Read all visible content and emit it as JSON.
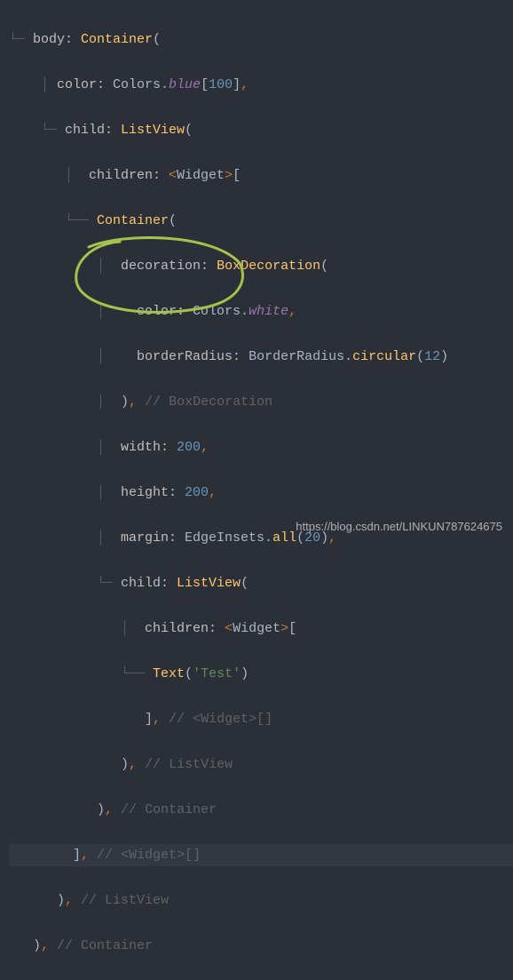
{
  "code": {
    "l1": {
      "tree": "└─ ",
      "p": "body: ",
      "cls": "Container",
      "open": "("
    },
    "l2": {
      "tree": "    │ ",
      "p": "color: ",
      "id": "Colors.",
      "ital": "blue",
      "br": "[",
      "n": "100",
      "cl": "]",
      "comma": ","
    },
    "l3": {
      "tree": "    └─ ",
      "p": "child: ",
      "cls": "ListView",
      "open": "("
    },
    "l4": {
      "tree": "       │  ",
      "p": "children: ",
      "ang1": "<",
      "w": "Widget",
      "ang2": ">",
      "open": "["
    },
    "l5": {
      "tree": "       └── ",
      "cls": "Container",
      "open": "("
    },
    "l6": {
      "tree": "           │  ",
      "p": "decoration: ",
      "cls": "BoxDecoration",
      "open": "("
    },
    "l7": {
      "tree": "           │    ",
      "p": "color: ",
      "id": "Colors.",
      "ital": "white",
      "comma": ","
    },
    "l8": {
      "tree": "           │    ",
      "p": "borderRadius: ",
      "id": "BorderRadius.",
      "m": "circular",
      "open": "(",
      "n": "12",
      "close": ")"
    },
    "l9": {
      "tree": "           │  ",
      "close": ")",
      "comma": ",",
      "cmt": " // BoxDecoration"
    },
    "l10": {
      "tree": "           │  ",
      "p": "width: ",
      "n": "200",
      "comma": ","
    },
    "l11": {
      "tree": "           │  ",
      "p": "height: ",
      "n": "200",
      "comma": ","
    },
    "l12": {
      "tree": "           │  ",
      "p": "margin: ",
      "id": "EdgeInsets.",
      "m": "all",
      "open": "(",
      "n": "20",
      "close": ")",
      "comma": ","
    },
    "l13": {
      "tree": "           └─ ",
      "p": "child: ",
      "cls": "ListView",
      "open": "("
    },
    "l14": {
      "tree": "              │  ",
      "p": "children: ",
      "ang1": "<",
      "w": "Widget",
      "ang2": ">",
      "open": "["
    },
    "l15": {
      "tree": "              └── ",
      "cls": "Text",
      "open": "(",
      "s": "'Test'",
      "close": ")"
    },
    "l16": {
      "tree": "                 ",
      "close": "]",
      "comma": ",",
      "cmt": " // <Widget>[]"
    },
    "l17": {
      "tree": "              ",
      "close": ")",
      "comma": ",",
      "cmt": " // ListView"
    },
    "l18": {
      "tree": "           ",
      "close": ")",
      "comma": ",",
      "cmt": " // Container"
    },
    "l19": {
      "tree": "        ",
      "close": "]",
      "comma": ",",
      "cmt": " // <Widget>[]"
    },
    "l20": {
      "tree": "      ",
      "close": ")",
      "comma": ",",
      "cmt": " // ListView"
    },
    "l21": {
      "tree": "   ",
      "close": ")",
      "comma": ",",
      "cmt": " // Container"
    }
  },
  "watermark": "https://blog.csdn.net/LINKUN787624675",
  "annotation_stroke": "#a6c24a"
}
